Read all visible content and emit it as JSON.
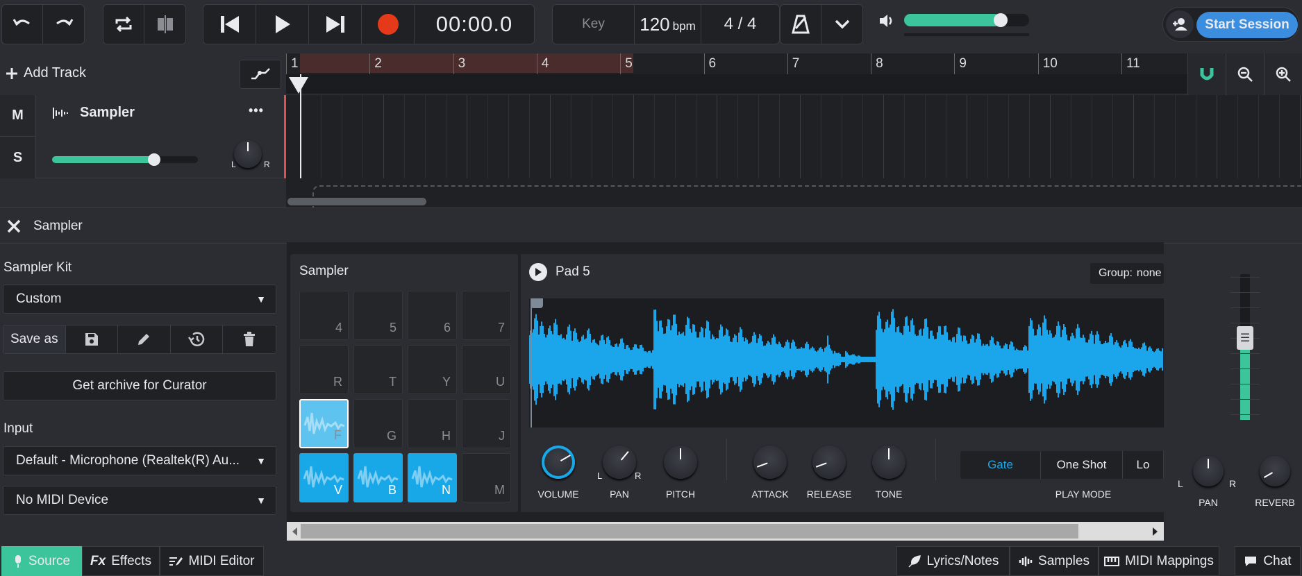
{
  "transport": {
    "time": "00:00.0",
    "key_label": "Key",
    "tempo": "120",
    "tempo_unit": "bpm",
    "time_signature": "4 / 4"
  },
  "volume": {
    "level": 0.77
  },
  "session": {
    "start_label": "Start Session"
  },
  "tracks_header": {
    "add_track_label": "Add Track"
  },
  "ruler": {
    "bars": [
      "1",
      "2",
      "3",
      "4",
      "5",
      "6",
      "7",
      "8",
      "9",
      "10",
      "11"
    ]
  },
  "track": {
    "mute": "M",
    "solo": "S",
    "name": "Sampler",
    "menu": "•••",
    "volume_level": 0.7,
    "pan_left": "L",
    "pan_right": "R"
  },
  "panel": {
    "title": "Sampler"
  },
  "left": {
    "kit_label": "Sampler Kit",
    "kit_value": "Custom",
    "save_as_label": "Save as",
    "archive_label": "Get archive for Curator",
    "input_label": "Input",
    "input_value": "Default - Microphone (Realtek(R) Au...",
    "midi_value": "No MIDI Device"
  },
  "sampler": {
    "title": "Sampler",
    "pads": [
      {
        "key": "4",
        "state": "empty"
      },
      {
        "key": "5",
        "state": "empty"
      },
      {
        "key": "6",
        "state": "empty"
      },
      {
        "key": "7",
        "state": "empty"
      },
      {
        "key": "R",
        "state": "empty"
      },
      {
        "key": "T",
        "state": "empty"
      },
      {
        "key": "Y",
        "state": "empty"
      },
      {
        "key": "U",
        "state": "empty"
      },
      {
        "key": "F",
        "state": "selected"
      },
      {
        "key": "G",
        "state": "empty"
      },
      {
        "key": "H",
        "state": "empty"
      },
      {
        "key": "J",
        "state": "empty"
      },
      {
        "key": "V",
        "state": "loaded"
      },
      {
        "key": "B",
        "state": "loaded"
      },
      {
        "key": "N",
        "state": "loaded"
      },
      {
        "key": "M",
        "state": "empty"
      }
    ]
  },
  "pad_editor": {
    "pad_name": "Pad 5",
    "group_label": "Group:",
    "group_value": "none",
    "knobs": [
      "VOLUME",
      "PAN",
      "PITCH",
      "ATTACK",
      "RELEASE",
      "TONE"
    ],
    "pan_left": "L",
    "pan_right": "R",
    "play_modes": [
      "Gate",
      "One Shot",
      "Lo"
    ],
    "active_play_mode": "Gate",
    "play_mode_label": "PLAY MODE"
  },
  "channel": {
    "pan_label": "PAN",
    "reverb_label": "REVERB",
    "pan_left": "L",
    "pan_right": "R",
    "fader_level": 0.55
  },
  "bottom": {
    "source": "Source",
    "effects_prefix": "Fx",
    "effects": "Effects",
    "midi_editor": "MIDI Editor",
    "lyrics": "Lyrics/Notes",
    "samples": "Samples",
    "midi_mappings": "MIDI Mappings",
    "chat": "Chat"
  },
  "colors": {
    "accent": "#18a8e8",
    "green": "#3cc49a",
    "record": "#e53a1a",
    "session_button": "#3b8de0"
  }
}
